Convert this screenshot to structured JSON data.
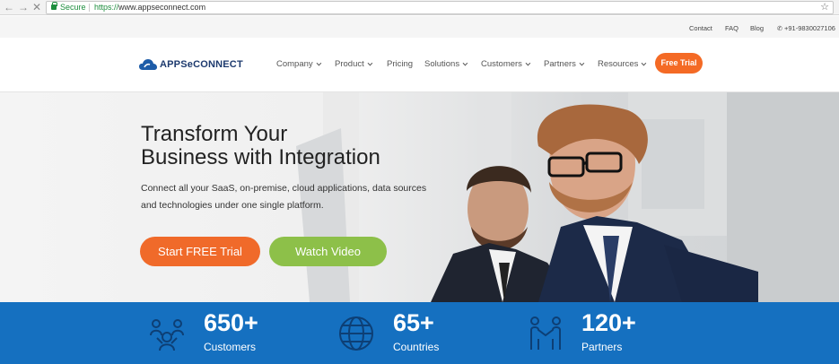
{
  "browser": {
    "secure_label": "Secure",
    "url_protocol": "https://",
    "url_host": "www.appseconnect.com",
    "back_icon": "back-arrow-icon",
    "forward_icon": "forward-arrow-icon",
    "close_icon": "close-icon",
    "bookmark_icon": "star-icon"
  },
  "topbar": {
    "links": [
      "Contact",
      "FAQ",
      "Blog"
    ],
    "phone": "+91-9830027106"
  },
  "header": {
    "logo": "APPSeCONNECT",
    "menu": [
      {
        "label": "Company",
        "has_dropdown": true
      },
      {
        "label": "Product",
        "has_dropdown": true
      },
      {
        "label": "Pricing",
        "has_dropdown": false
      },
      {
        "label": "Solutions",
        "has_dropdown": true
      },
      {
        "label": "Customers",
        "has_dropdown": true
      },
      {
        "label": "Partners",
        "has_dropdown": true
      },
      {
        "label": "Resources",
        "has_dropdown": true
      }
    ],
    "cta": "Free Trial"
  },
  "hero": {
    "title_line1": "Transform Your",
    "title_line2": "Business with Integration",
    "subtitle": "Connect all your SaaS, on-premise, cloud applications, data sources and technologies under one single platform.",
    "primary_button": "Start FREE Trial",
    "secondary_button": "Watch Video"
  },
  "stats": [
    {
      "value": "650+",
      "label": "Customers",
      "icon": "people-icon"
    },
    {
      "value": "65+",
      "label": "Countries",
      "icon": "globe-icon"
    },
    {
      "value": "120+",
      "label": "Partners",
      "icon": "handshake-icon"
    }
  ],
  "colors": {
    "accent_orange": "#f46a25",
    "accent_green": "#8dc049",
    "stats_blue": "#1570c0",
    "brand_navy": "#1d3a6e"
  }
}
